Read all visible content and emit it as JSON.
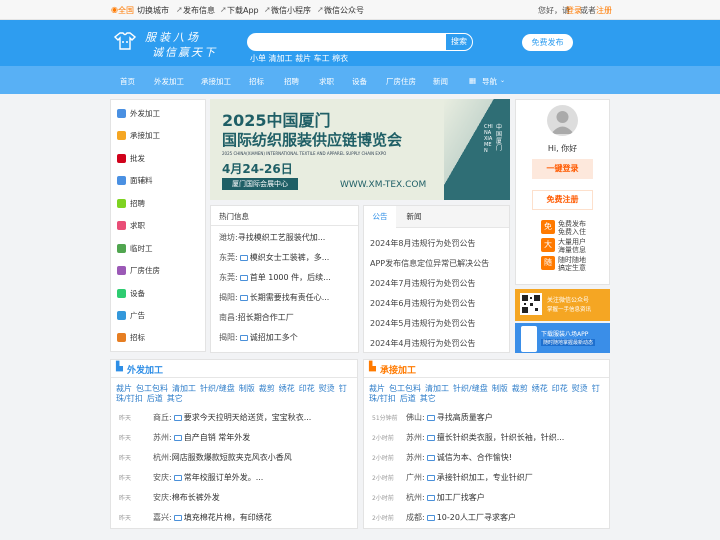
{
  "topbar": {
    "city": "全国",
    "switch_city": "切换城市",
    "post_info": "发布信息",
    "download_app": "下载App",
    "mini_program": "微信小程序",
    "official_account": "微信公众号",
    "greeting": "您好，请",
    "login": "登录",
    "or": "或者",
    "register": "注册"
  },
  "header": {
    "logo_line1": "服装八场",
    "logo_line2": "诚信赢天下",
    "search_button": "搜索",
    "search_hints": "小单 清加工 裁片 车工 棉衣",
    "post_free": "免费发布"
  },
  "nav": {
    "items": [
      "首页",
      "外发加工",
      "承接加工",
      "招标",
      "招聘",
      "求职",
      "设备",
      "厂房住房",
      "新闻"
    ],
    "more": "导航"
  },
  "sidebar": {
    "items": [
      {
        "label": "外发加工",
        "color": "#4a90e2"
      },
      {
        "label": "承接加工",
        "color": "#f5a623"
      },
      {
        "label": "批发",
        "color": "#d0021b"
      },
      {
        "label": "面辅料",
        "color": "#4a90e2"
      },
      {
        "label": "招聘",
        "color": "#7ed321"
      },
      {
        "label": "求职",
        "color": "#e94e77"
      },
      {
        "label": "临时工",
        "color": "#50a54f"
      },
      {
        "label": "厂房住房",
        "color": "#9b59b6"
      },
      {
        "label": "设备",
        "color": "#2ecc71"
      },
      {
        "label": "广告",
        "color": "#3498db"
      },
      {
        "label": "招标",
        "color": "#e67e22"
      }
    ]
  },
  "banner": {
    "title1": "2025中国厦门",
    "title2": "国际纺织服装供应链博览会",
    "subtitle": "2025 CHINA(XIAMEN) INTERNATIONAL TEXTILE AND APPAREL SUPPLY CHAIN EXPO",
    "date": "4月24-26日",
    "venue": "厦门国际会展中心",
    "url": "WWW.XM-TEX.COM",
    "side_en": "CHINA XIAMEN",
    "side_cn": "中国厦门"
  },
  "hot": {
    "title": "热门信息",
    "items": [
      {
        "city": "潍坊:",
        "text": "寻找模织工艺服装代加...",
        "pic": false
      },
      {
        "city": "东莞:",
        "text": "模织女士工装裤，多...",
        "pic": true
      },
      {
        "city": "东莞:",
        "text": "首单 1000 件，后续...",
        "pic": true
      },
      {
        "city": "揭阳:",
        "text": "长期需要找有责任心...",
        "pic": true
      },
      {
        "city": "南昌:",
        "text": "招长期合作工厂",
        "pic": false
      },
      {
        "city": "揭阳:",
        "text": "诚招加工多个",
        "pic": true
      }
    ]
  },
  "notice": {
    "tab_active": "公告",
    "tab_other": "新闻",
    "items": [
      "2024年8月违规行为处罚公告",
      "APP发布信息定位异常已解决公告",
      "2024年7月违规行为处罚公告",
      "2024年6月违规行为处罚公告",
      "2024年5月违规行为处罚公告",
      "2024年4月违规行为处罚公告"
    ]
  },
  "user": {
    "greeting": "Hi, 你好",
    "login_button": "一键登录",
    "register_button": "免费注册",
    "features": [
      {
        "icon": "免",
        "a": "免费发布",
        "b": "免费入住"
      },
      {
        "icon": "大",
        "a": "大量用户",
        "b": "海量信息"
      },
      {
        "icon": "随",
        "a": "随时随地",
        "b": "搞定生意"
      }
    ],
    "ad1_line1": "关注微信公众号",
    "ad1_line2": "掌握一手信息资讯",
    "ad2_line1": "下载服装八场APP",
    "ad2_line2": "随时随地掌握最新动态"
  },
  "outsource": {
    "title": "外发加工",
    "cats": [
      "裁片",
      "包工包料",
      "清加工",
      "针织/缝盘",
      "制版",
      "裁剪",
      "绣花",
      "印花",
      "熨烫",
      "钉珠/钉扣",
      "后道",
      "其它"
    ],
    "items": [
      {
        "time": "昨天",
        "city": "商丘:",
        "text": "要求今天拉明天给送货，宝宝秋衣...",
        "pic": true
      },
      {
        "time": "昨天",
        "city": "苏州:",
        "text": "自产自销 常年外发",
        "pic": true
      },
      {
        "time": "昨天",
        "city": "杭州:",
        "text": "网店服数爆款短款夹克风衣小香风",
        "pic": false
      },
      {
        "time": "昨天",
        "city": "安庆:",
        "text": "常年校服订单外发。...",
        "pic": true
      },
      {
        "time": "昨天",
        "city": "安庆:",
        "text": "棉布长裤外发",
        "pic": false
      },
      {
        "time": "昨天",
        "city": "嘉兴:",
        "text": "填充棉花片棉，有印绣花",
        "pic": true
      }
    ]
  },
  "contract": {
    "title": "承接加工",
    "cats": [
      "裁片",
      "包工包料",
      "清加工",
      "针织/缝盘",
      "制版",
      "裁剪",
      "绣花",
      "印花",
      "熨烫",
      "钉珠/钉扣",
      "后道",
      "其它"
    ],
    "items": [
      {
        "time": "51分钟前",
        "city": "佛山:",
        "text": "寻找高质量客户",
        "pic": true
      },
      {
        "time": "2小时前",
        "city": "苏州:",
        "text": "擅长针织类衣服，针织长袖，针织...",
        "pic": true
      },
      {
        "time": "2小时前",
        "city": "苏州:",
        "text": "诚信为本、合作愉快!",
        "pic": true
      },
      {
        "time": "2小时前",
        "city": "广州:",
        "text": "承接针织加工，专业针织厂",
        "pic": true
      },
      {
        "time": "2小时前",
        "city": "杭州:",
        "text": "加工厂找客户",
        "pic": true
      },
      {
        "time": "2小时前",
        "city": "成都:",
        "text": "10-20人工厂寻求客户",
        "pic": true
      }
    ]
  },
  "colors": {
    "header": "#2e9df0",
    "nav": "#58b0f5",
    "accent": "#2e8ee6",
    "orange": "#ff7a00",
    "banner_bg": "#e8ede0",
    "banner_side": "#2f6e75"
  }
}
